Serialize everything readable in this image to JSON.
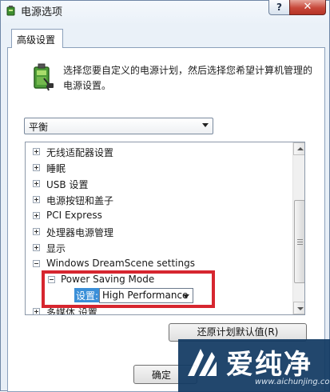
{
  "window": {
    "title": "电源选项",
    "help_label": "?",
    "close_label": "✕"
  },
  "tab": {
    "label": "高级设置"
  },
  "description": "选择您要自定义的电源计划，然后选择您希望计算机管理的电源设置。",
  "plan_select": {
    "value": "平衡"
  },
  "tree": {
    "items": [
      {
        "label": "无线适配器设置"
      },
      {
        "label": "睡眠"
      },
      {
        "label": "USB 设置"
      },
      {
        "label": "电源按钮和盖子"
      },
      {
        "label": "PCI Express"
      },
      {
        "label": "处理器电源管理"
      },
      {
        "label": "显示"
      },
      {
        "label": "Windows DreamScene settings"
      },
      {
        "label": "Power Saving Mode"
      },
      {
        "label": "多媒体 设置"
      }
    ],
    "setting_label": "设置:",
    "setting_value": "High Performance"
  },
  "buttons": {
    "restore": "还原计划默认值(R)",
    "ok": "确定"
  },
  "watermark": {
    "text": "爱纯净",
    "url": "www.aichunjing.com"
  },
  "colors": {
    "highlight_border": "#d6262f",
    "selection": "#3a8fd8",
    "watermark_bg": "#123a63"
  }
}
